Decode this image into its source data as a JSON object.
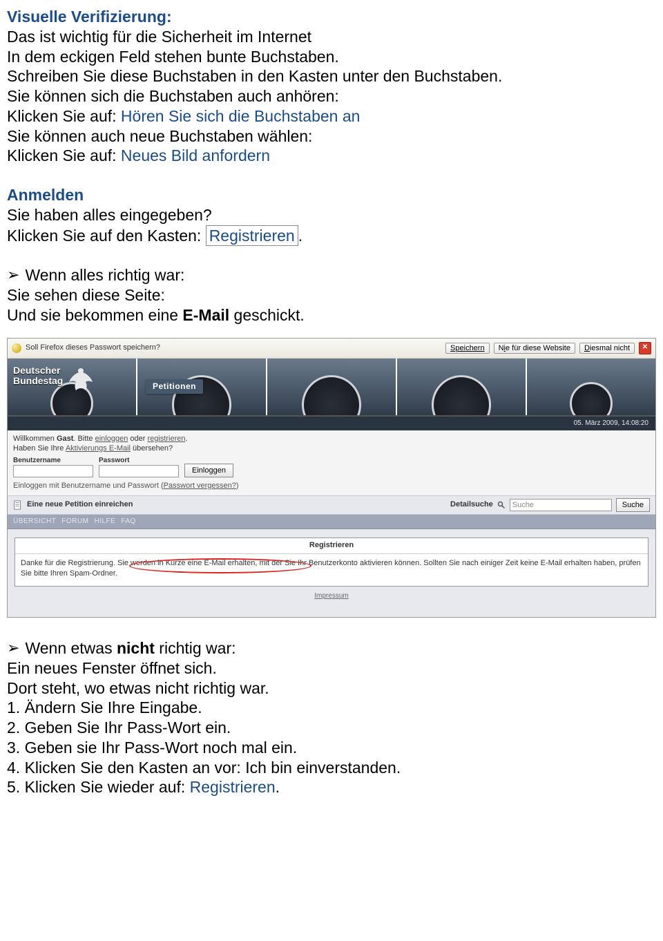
{
  "doc": {
    "h1": "Visuelle Verifizierung:",
    "p1_l1": "Das ist wichtig für die Sicherheit im Internet",
    "p1_l2": "In dem eckigen Feld stehen bunte Buchstaben.",
    "p1_l3": "Schreiben Sie diese Buchstaben in den Kasten unter den Buchstaben.",
    "p2_l1": "Sie können sich die Buchstaben auch anhören:",
    "p2_l2a": "Klicken Sie auf: ",
    "p2_l2b": "Hören Sie sich die Buchstaben an",
    "p2_l3": "Sie können auch neue Buchstaben wählen:",
    "p2_l4a": "Klicken Sie auf: ",
    "p2_l4b": "Neues Bild anfordern",
    "h2": "Anmelden",
    "p3_l1": "Sie haben alles eingegeben?",
    "p3_l2a": "Klicken Sie auf den Kasten: ",
    "p3_l2b": "Registrieren",
    "p3_l2c": ".",
    "bullet1": "Wenn alles richtig war:",
    "p4_l1": "Sie sehen diese Seite:",
    "p4_l2a": "Und sie bekommen eine ",
    "p4_l2b": "E-Mail",
    "p4_l2c": " geschickt.",
    "bullet2a": "Wenn etwas ",
    "bullet2b": "nicht",
    "bullet2c": " richtig war:",
    "p5_l1": "Ein neues Fenster öffnet sich.",
    "p5_l2": "Dort steht, wo etwas nicht richtig war.",
    "p5_l3": "1. Ändern Sie Ihre Eingabe.",
    "p5_l4": "2. Geben Sie Ihr Pass-Wort ein.",
    "p5_l5": "3. Geben sie Ihr Pass-Wort noch mal ein.",
    "p5_l6": "4. Klicken Sie den Kasten an vor: Ich bin einverstanden.",
    "p5_l7a": "5. Klicken Sie wieder auf: ",
    "p5_l7b": "Registrieren",
    "p5_l7c": "."
  },
  "shot": {
    "ff_prompt": "Soll Firefox dieses Passwort speichern?",
    "btn_save": "Speichern",
    "btn_never_pre": "N",
    "btn_never_u": "i",
    "btn_never_post": "e für diese Website",
    "btn_notnow_pre": "",
    "btn_notnow_u": "D",
    "btn_notnow_post": "iesmal nicht",
    "logo_l1": "Deutscher",
    "logo_l2": "Bundestag",
    "petitionen": "Petitionen",
    "date": "05. März 2009, 14:08:20",
    "welcome_a": "Willkommen ",
    "welcome_b": "Gast",
    "welcome_c": ". Bitte ",
    "welcome_d": "einloggen",
    "welcome_e": " oder ",
    "welcome_f": "registrieren",
    "welcome_g": ".",
    "activation_a": "Haben Sie Ihre ",
    "activation_b": "Aktivierungs E-Mail",
    "activation_c": " übersehen?",
    "label_user": "Benutzername",
    "label_pass": "Passwort",
    "btn_login": "Einloggen",
    "forgot_a": "Einloggen mit Benutzername und Passwort (",
    "forgot_b": "Passwort vergessen?",
    "forgot_c": ")",
    "new_petition": "Eine neue Petition einreichen",
    "detailsuche": "Detailsuche",
    "search_placeholder": "Suche",
    "btn_search": "Suche",
    "nav1": "ÜBERSICHT",
    "nav2": "FORUM",
    "nav3": "HILFE",
    "nav4": "FAQ",
    "msg_title": "Registrieren",
    "msg_body": "Danke für die Registrierung. Sie werden in Kürze eine E-Mail erhalten, mit der Sie Ihr Benutzerkonto aktivieren können. Sollten Sie nach einiger Zeit keine E-Mail erhalten haben, prüfen Sie bitte Ihren Spam-Ordner.",
    "impressum": "Impressum"
  }
}
